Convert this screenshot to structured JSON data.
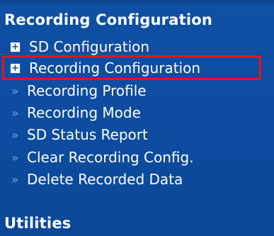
{
  "section_recording": {
    "title": "Recording Configuration"
  },
  "menu": {
    "items": [
      {
        "label": "SD Configuration",
        "type": "expander",
        "icon": "plus-box-icon"
      },
      {
        "label": "Recording Configuration",
        "type": "expander",
        "icon": "plus-box-icon",
        "highlighted": true
      },
      {
        "label": "Recording Profile",
        "type": "link",
        "icon": "double-chevron-icon"
      },
      {
        "label": "Recording Mode",
        "type": "link",
        "icon": "double-chevron-icon"
      },
      {
        "label": "SD Status Report",
        "type": "link",
        "icon": "double-chevron-icon"
      },
      {
        "label": "Clear Recording Config.",
        "type": "link",
        "icon": "double-chevron-icon"
      },
      {
        "label": "Delete Recorded Data",
        "type": "link",
        "icon": "double-chevron-icon"
      }
    ]
  },
  "section_utilities": {
    "title": "Utilities"
  },
  "colors": {
    "background": "#0d4ca0",
    "text": "#ffffff",
    "highlight_border": "#e8131b",
    "bullet": "#5f8fd2"
  }
}
